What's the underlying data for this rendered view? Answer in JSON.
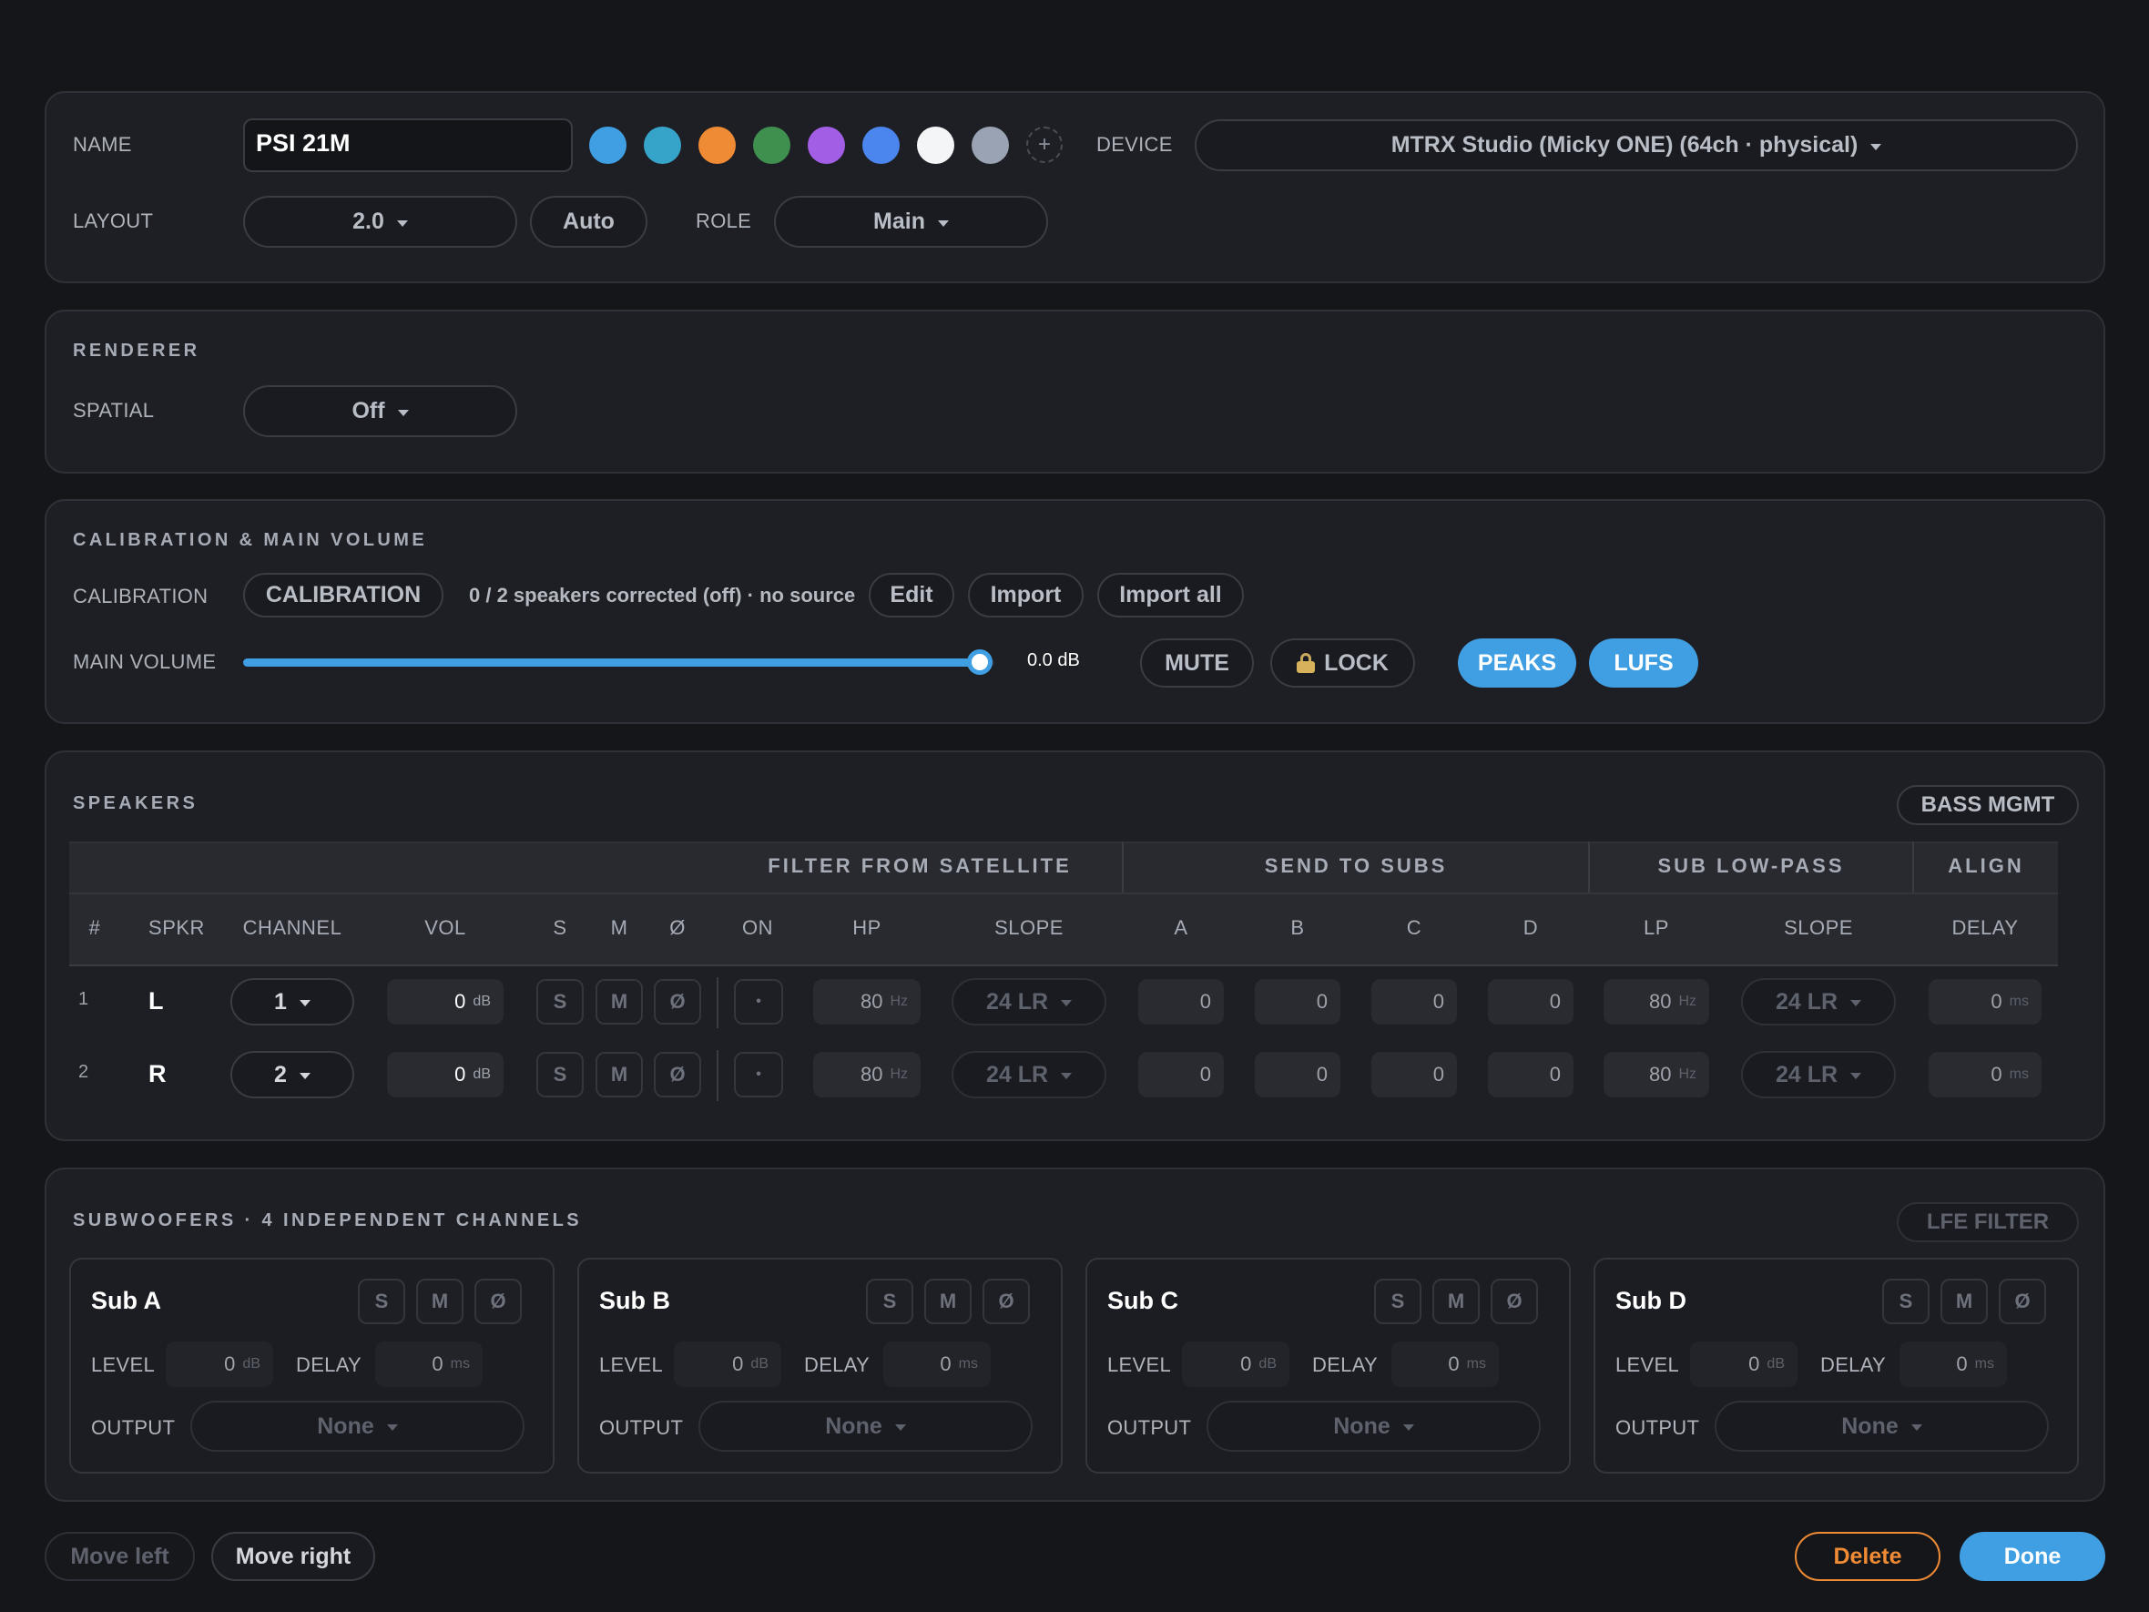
{
  "general": {
    "name_label": "NAME",
    "name_value": "PSI 21M",
    "add_color": "+",
    "device_label": "DEVICE",
    "device_value": "MTRX Studio (Micky ONE) (64ch · physical)",
    "layout_label": "LAYOUT",
    "layout_value": "2.0",
    "auto_label": "Auto",
    "role_label": "ROLE",
    "role_value": "Main",
    "colors": [
      "#3f9fe2",
      "#36a3c9",
      "#ef8a35",
      "#3f8f4f",
      "#a35ee6",
      "#4a86ee",
      "#f4f5f7",
      "#9aa3b3"
    ]
  },
  "renderer": {
    "title": "RENDERER",
    "spatial_label": "SPATIAL",
    "spatial_value": "Off"
  },
  "calibration": {
    "title": "CALIBRATION & MAIN VOLUME",
    "cal_label": "CALIBRATION",
    "cal_button": "CALIBRATION",
    "status": "0 / 2 speakers corrected (off) · no source",
    "edit": "Edit",
    "import": "Import",
    "import_all": "Import all",
    "volume_label": "MAIN VOLUME",
    "volume_value": "0.0 dB",
    "volume_fraction": 1.0,
    "mute": "MUTE",
    "lock": "LOCK",
    "peaks": "PEAKS",
    "lufs": "LUFS"
  },
  "speakers": {
    "title": "SPEAKERS",
    "bass_mgmt": "BASS MGMT",
    "groups": {
      "filter": "FILTER FROM SATELLITE",
      "send": "SEND TO SUBS",
      "lowpass": "SUB LOW-PASS",
      "align": "ALIGN"
    },
    "columns": {
      "num": "#",
      "spkr": "SPKR",
      "channel": "CHANNEL",
      "vol": "VOL",
      "s": "S",
      "m": "M",
      "phase": "Ø",
      "on": "ON",
      "hp": "HP",
      "slope": "SLOPE",
      "a": "A",
      "b": "B",
      "c": "C",
      "d": "D",
      "lp": "LP",
      "slope2": "SLOPE",
      "delay": "DELAY"
    },
    "rows": [
      {
        "num": "1",
        "spkr": "L",
        "channel": "1",
        "vol": "0",
        "vol_unit": "dB",
        "s": "S",
        "m": "M",
        "phase": "Ø",
        "on": "•",
        "hp": "80",
        "hp_unit": "Hz",
        "slope": "24 LR",
        "a": "0",
        "b": "0",
        "c": "0",
        "d": "0",
        "lp": "80",
        "lp_unit": "Hz",
        "slope2": "24 LR",
        "delay": "0",
        "delay_unit": "ms"
      },
      {
        "num": "2",
        "spkr": "R",
        "channel": "2",
        "vol": "0",
        "vol_unit": "dB",
        "s": "S",
        "m": "M",
        "phase": "Ø",
        "on": "•",
        "hp": "80",
        "hp_unit": "Hz",
        "slope": "24 LR",
        "a": "0",
        "b": "0",
        "c": "0",
        "d": "0",
        "lp": "80",
        "lp_unit": "Hz",
        "slope2": "24 LR",
        "delay": "0",
        "delay_unit": "ms"
      }
    ]
  },
  "subwoofers": {
    "title": "SUBWOOFERS · 4 INDEPENDENT CHANNELS",
    "lfe_filter": "LFE FILTER",
    "level_label": "LEVEL",
    "delay_label": "DELAY",
    "output_label": "OUTPUT",
    "cards": [
      {
        "name": "Sub A",
        "s": "S",
        "m": "M",
        "phase": "Ø",
        "level": "0",
        "level_unit": "dB",
        "delay": "0",
        "delay_unit": "ms",
        "output": "None"
      },
      {
        "name": "Sub B",
        "s": "S",
        "m": "M",
        "phase": "Ø",
        "level": "0",
        "level_unit": "dB",
        "delay": "0",
        "delay_unit": "ms",
        "output": "None"
      },
      {
        "name": "Sub C",
        "s": "S",
        "m": "M",
        "phase": "Ø",
        "level": "0",
        "level_unit": "dB",
        "delay": "0",
        "delay_unit": "ms",
        "output": "None"
      },
      {
        "name": "Sub D",
        "s": "S",
        "m": "M",
        "phase": "Ø",
        "level": "0",
        "level_unit": "dB",
        "delay": "0",
        "delay_unit": "ms",
        "output": "None"
      }
    ]
  },
  "footer": {
    "move_left": "Move left",
    "move_right": "Move right",
    "delete": "Delete",
    "done": "Done"
  }
}
